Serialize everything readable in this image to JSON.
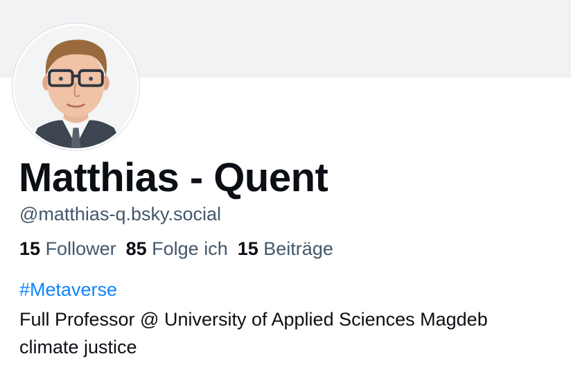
{
  "profile": {
    "display_name": "Matthias - Quent",
    "handle": "@matthias-q.bsky.social",
    "avatar_icon": "profile-photo"
  },
  "stats": {
    "followers_count": "15",
    "followers_label": "Follower",
    "following_count": "85",
    "following_label": "Folge ich",
    "posts_count": "15",
    "posts_label": "Beiträge"
  },
  "bio": {
    "hashtag": "#Metaverse",
    "line1": "Full Professor @ University of Applied Sciences Magdeb",
    "line2": "climate justice"
  },
  "colors": {
    "banner": "#f1f2f4",
    "text_primary": "#0b0f14",
    "text_secondary": "#42576c",
    "link": "#1083fe"
  }
}
